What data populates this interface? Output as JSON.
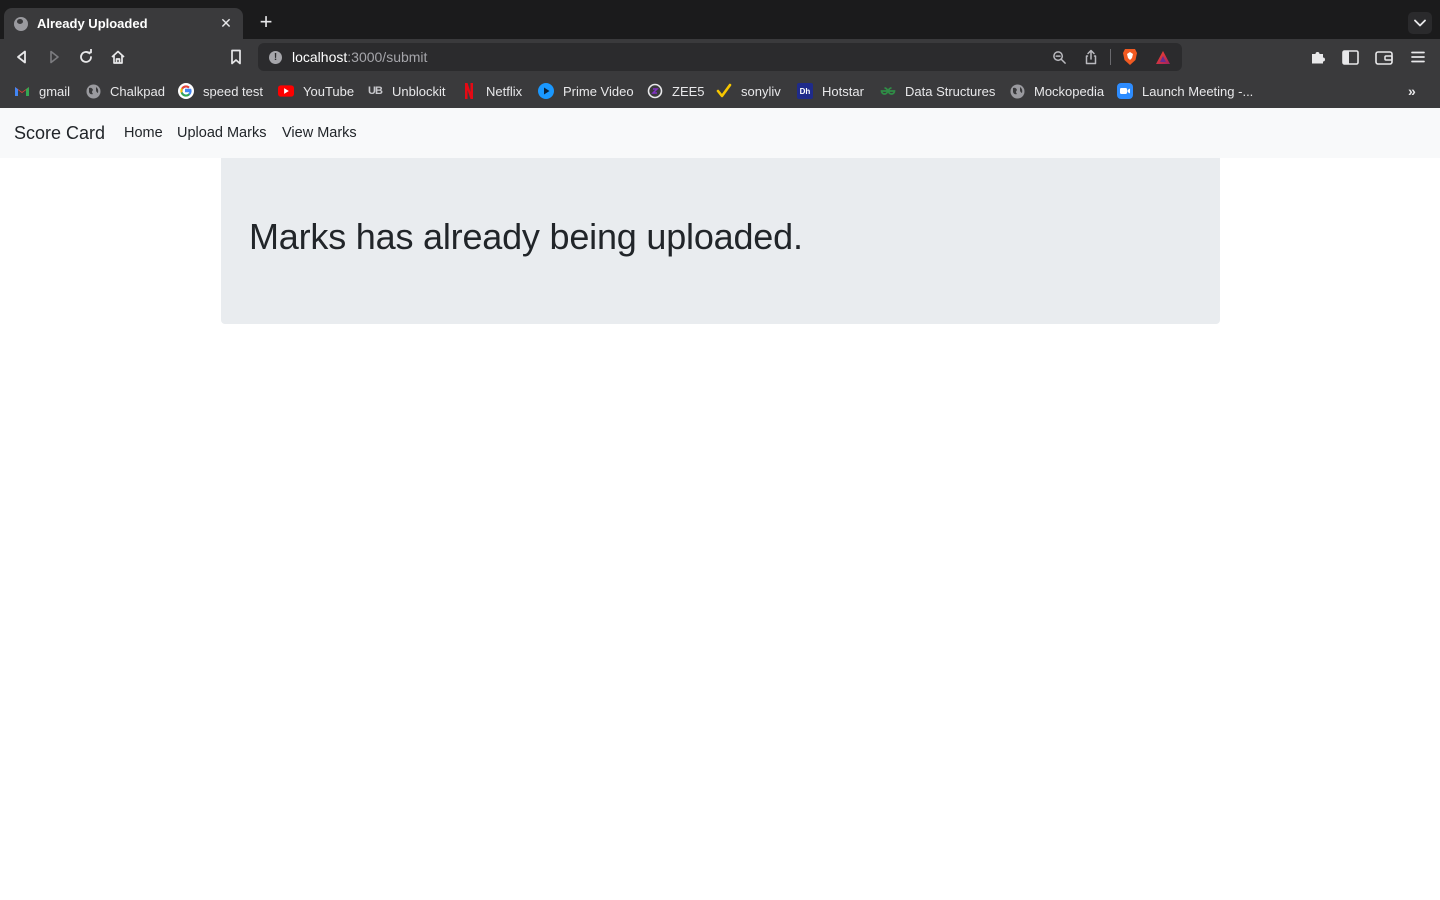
{
  "browser": {
    "tab": {
      "title": "Already Uploaded",
      "close": "✕"
    },
    "new_tab": "+",
    "url": {
      "host": "localhost",
      "path": ":3000/submit"
    },
    "bookmarks": [
      {
        "label": "gmail",
        "icon": "gmail-icon"
      },
      {
        "label": "Chalkpad",
        "icon": "globe-icon"
      },
      {
        "label": "speed test",
        "icon": "google-icon"
      },
      {
        "label": "YouTube",
        "icon": "youtube-icon"
      },
      {
        "label": "Unblockit",
        "icon": "unblockit-icon"
      },
      {
        "label": "Netflix",
        "icon": "netflix-icon"
      },
      {
        "label": "Prime Video",
        "icon": "prime-video-icon"
      },
      {
        "label": "ZEE5",
        "icon": "zee5-icon"
      },
      {
        "label": "sonyliv",
        "icon": "sonyliv-icon"
      },
      {
        "label": "Hotstar",
        "icon": "hotstar-icon"
      },
      {
        "label": "Data Structures",
        "icon": "geeksforgeeks-icon"
      },
      {
        "label": "Mockopedia",
        "icon": "globe-icon"
      },
      {
        "label": "Launch Meeting -...",
        "icon": "zoom-icon"
      }
    ],
    "more_bookmarks": "»"
  },
  "navbar": {
    "brand": "Score Card",
    "links": [
      "Home",
      "Upload Marks",
      "View Marks"
    ]
  },
  "main": {
    "message": "Marks has already being uploaded."
  },
  "colors": {
    "navbar_bg": "#f8f9fa",
    "jumbotron_bg": "#e9ecef",
    "text": "#212529"
  }
}
